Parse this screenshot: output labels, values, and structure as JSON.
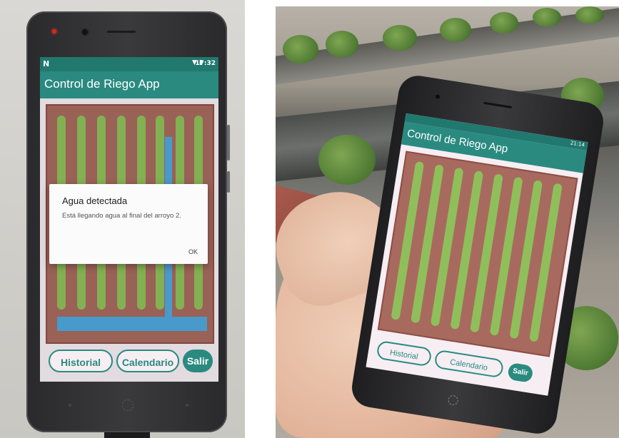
{
  "left_photo": {
    "status_bar": {
      "notification": "N",
      "icons": "▼ ▮",
      "time": "17:32"
    },
    "app_title": "Control de Riego App",
    "dialog": {
      "title": "Agua detectada",
      "message": "Está llegando agua al final del arroyo 2.",
      "ok_label": "OK"
    },
    "buttons": {
      "historial": "Historial",
      "calendario": "Calendario",
      "salir": "Salir"
    },
    "colors": {
      "app_bar": "#2a8a80",
      "furrow": "#8fbf5a",
      "soil": "#a86a5e",
      "water": "#4ea8dd"
    }
  },
  "right_photo": {
    "status_bar": {
      "icons": "▼ ▮",
      "time": "21:14"
    },
    "app_title": "Control de Riego App",
    "buttons": {
      "historial": "Historial",
      "calendario": "Calendario",
      "salir": "Salir"
    }
  }
}
